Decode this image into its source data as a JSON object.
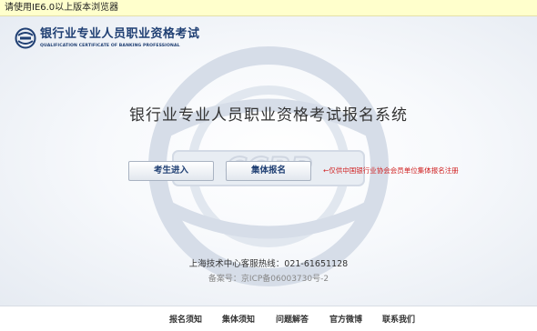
{
  "browser_notice": "请使用IE6.0以上版本浏览器",
  "logo": {
    "cn": "银行业专业人员职业资格考试",
    "en": "QUALIFICATION CERTIFICATE OF BANKING PROFESSIONAL"
  },
  "main_title": "银行业专业人员职业资格考试报名系统",
  "buttons": {
    "candidate_login": "考生进入",
    "group_register": "集体报名"
  },
  "group_note": "←仅供中国银行业协会会员单位集体报名注册",
  "watermark_text": "CCBP",
  "hotline": "上海技术中心客服热线：021-61651128",
  "icp": "备案号：京ICP备06003730号-2",
  "footer_links": [
    "报名须知",
    "集体须知",
    "问题解答",
    "官方微博",
    "联系我们"
  ],
  "colors": {
    "brand": "#1f3f73",
    "note": "#d02020",
    "notice_bar": "#ffffcc"
  }
}
